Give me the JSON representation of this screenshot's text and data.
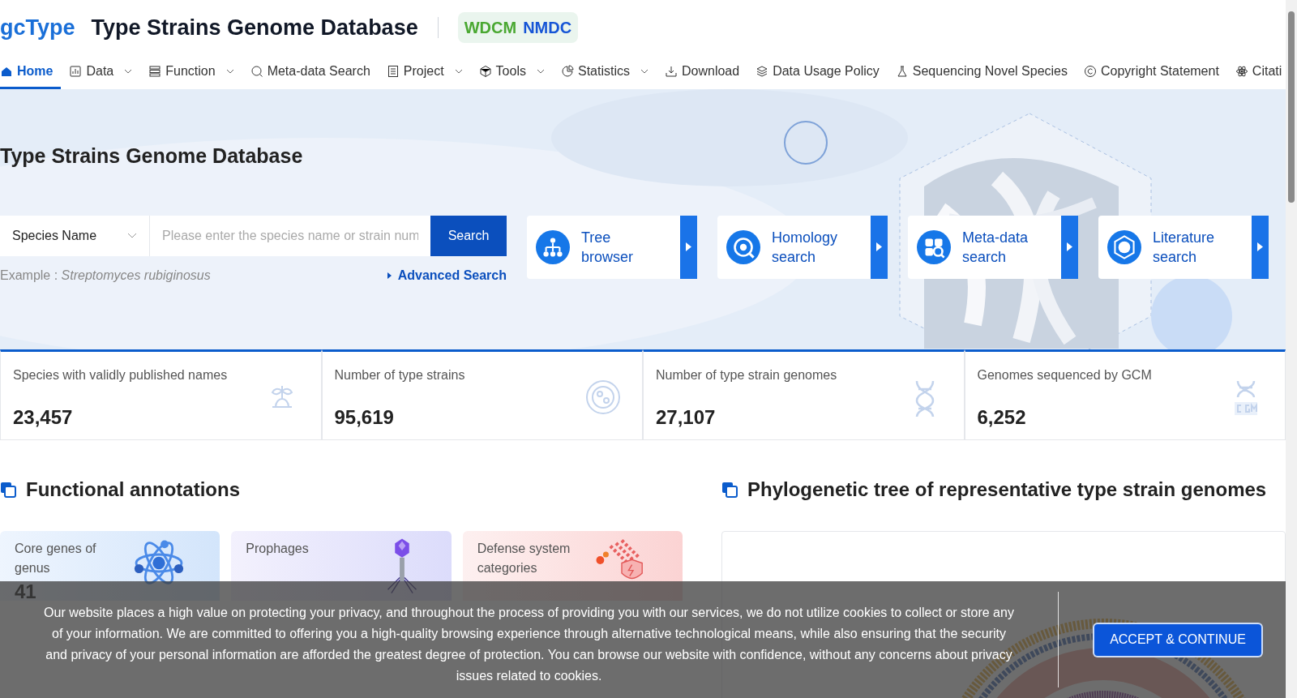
{
  "header": {
    "logo": "gcType",
    "title": "Type Strains Genome Database",
    "badges": [
      "WDCM",
      "NMDC"
    ]
  },
  "nav": [
    {
      "label": "Home",
      "selected": true,
      "dropdown": false
    },
    {
      "label": "Data",
      "selected": false,
      "dropdown": true
    },
    {
      "label": "Function",
      "selected": false,
      "dropdown": true
    },
    {
      "label": "Meta-data Search",
      "selected": false,
      "dropdown": false
    },
    {
      "label": "Project",
      "selected": false,
      "dropdown": true
    },
    {
      "label": "Tools",
      "selected": false,
      "dropdown": true
    },
    {
      "label": "Statistics",
      "selected": false,
      "dropdown": true
    },
    {
      "label": "Download",
      "selected": false,
      "dropdown": false
    },
    {
      "label": "Data Usage Policy",
      "selected": false,
      "dropdown": false
    },
    {
      "label": "Sequencing Novel Species",
      "selected": false,
      "dropdown": false
    },
    {
      "label": "Copyright Statement",
      "selected": false,
      "dropdown": false
    },
    {
      "label": "Citati",
      "selected": false,
      "dropdown": false
    }
  ],
  "hero": {
    "title": "Type Strains Genome Database",
    "search": {
      "field": "Species Name",
      "placeholder": "Please enter the species name or strain num",
      "button": "Search"
    },
    "example_label": "Example : ",
    "example": "Streptomyces rubiginosus",
    "advanced": "Advanced Search",
    "features": [
      {
        "line1": "Tree",
        "line2": "browser"
      },
      {
        "line1": "Homology",
        "line2": "search"
      },
      {
        "line1": "Meta-data",
        "line2": "search"
      },
      {
        "line1": "Literature",
        "line2": "search"
      }
    ]
  },
  "stats": [
    {
      "label": "Species with validly published names",
      "value": "23,457"
    },
    {
      "label": "Number of type strains",
      "value": "95,619"
    },
    {
      "label": "Number of type strain genomes",
      "value": "27,107"
    },
    {
      "label": "Genomes sequenced by GCM",
      "value": "6,252"
    }
  ],
  "functional": {
    "title": "Functional annotations",
    "cards": [
      {
        "label": "Core genes of genus",
        "value": "41"
      },
      {
        "label": "Prophages"
      },
      {
        "label": "Defense system categories"
      }
    ]
  },
  "phylo": {
    "title": "Phylogenetic tree of representative type strain genomes"
  },
  "cookie": {
    "text": "Our website places a high value on protecting your privacy, and throughout the process of providing you with our services, we do not utilize cookies to collect or store any of your information. We are committed to offering you a high-quality browsing experience through alternative technological means, while also ensuring that the security and privacy of your personal information are afforded the greatest degree of protection. You can browse our website with confidence, without any concerns about privacy issues related to cookies.",
    "button": "ACCEPT & CONTINUE"
  }
}
